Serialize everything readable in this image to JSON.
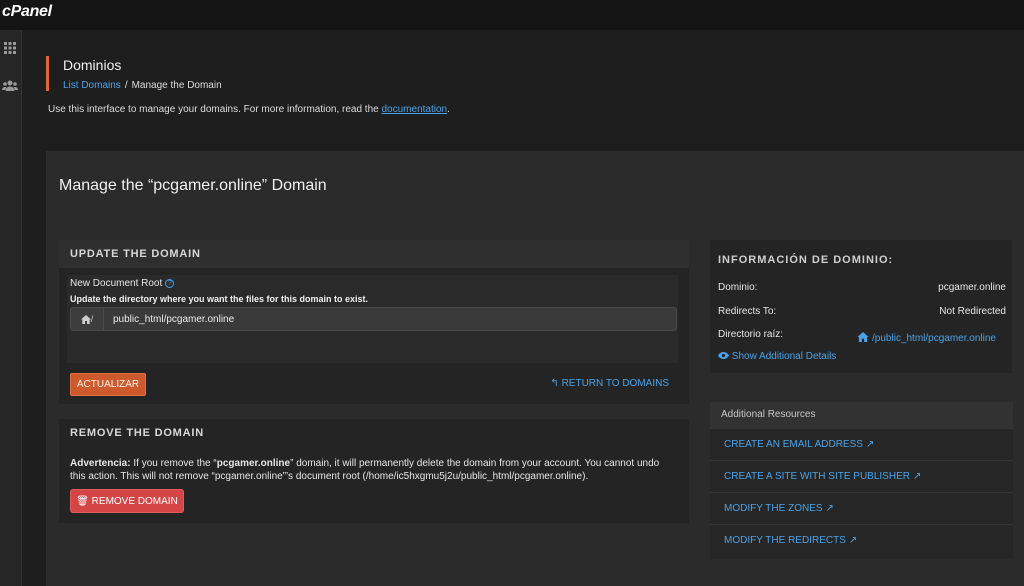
{
  "app": {
    "logo": "cPanel"
  },
  "header": {
    "title": "Dominios",
    "breadcrumb": {
      "link": "List Domains",
      "separator": "/",
      "current": "Manage the Domain"
    }
  },
  "intro": {
    "text": "Use this interface to manage your domains. For more information, read the ",
    "link": "documentation",
    "end": "."
  },
  "manage_title": "Manage the “pcgamer.online” Domain",
  "update": {
    "heading": "UPDATE THE DOMAIN",
    "label": "New Document Root",
    "help": "Update the directory where you want the files for this domain to exist.",
    "prefix": "/",
    "value": "public_html/pcgamer.online",
    "button": "ACTUALIZAR",
    "return_link": "RETURN TO DOMAINS"
  },
  "remove": {
    "heading": "REMOVE THE DOMAIN",
    "warning_label": "Advertencia:",
    "warning_a": " If you remove the “",
    "warning_domain": "pcgamer.online",
    "warning_b": "” domain, it will permanently delete the domain from your account. You cannot undo this action. This will not remove “pcgamer.online”’s document root (/home/ic5hxgmu5j2u/public_html/pcgamer.online).",
    "button": "REMOVE DOMAIN"
  },
  "info": {
    "heading": "INFORMACIÓN DE DOMINIO:",
    "rows": [
      {
        "label": "Dominio:",
        "value": "pcgamer.online"
      },
      {
        "label": "Redirects To:",
        "value": "Not Redirected"
      },
      {
        "label": "Directorio raíz:",
        "value": "/public_html/pcgamer.online"
      }
    ],
    "show_details": "Show Additional Details"
  },
  "resources": {
    "heading": "Additional Resources",
    "items": [
      "CREATE AN EMAIL ADDRESS",
      "CREATE A SITE WITH SITE PUBLISHER",
      "MODIFY THE ZONES",
      "MODIFY THE REDIRECTS"
    ]
  },
  "colors": {
    "accent": "#e0672f",
    "link": "#4aa3e8",
    "danger": "#d64545",
    "update_button": "#cd5a2d"
  }
}
